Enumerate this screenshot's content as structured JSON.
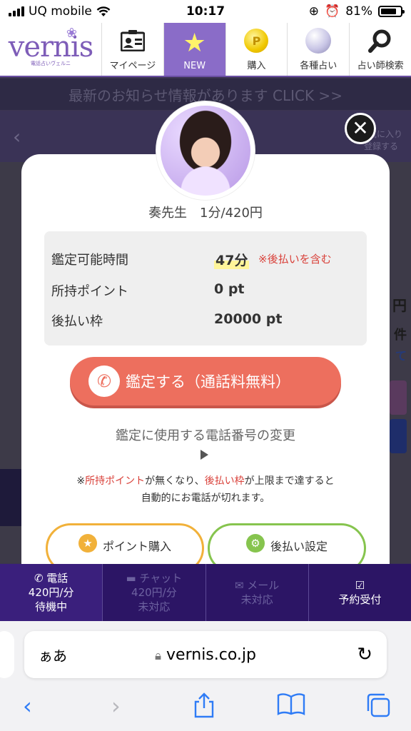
{
  "status_bar": {
    "carrier": "UQ mobile",
    "time": "10:17",
    "battery": "81%",
    "battery_level": 0.81
  },
  "header": {
    "logo": {
      "word": "vernis",
      "sub": "電話占いヴェルニ"
    },
    "nav": [
      {
        "label": "マイページ",
        "icon": "id-card-icon"
      },
      {
        "label": "NEW",
        "icon": "star-icon"
      },
      {
        "label": "購入",
        "icon": "coin-icon",
        "glyph": "P"
      },
      {
        "label": "各種占い",
        "icon": "crystal-ball-icon"
      },
      {
        "label": "占い師検索",
        "icon": "search-icon"
      }
    ]
  },
  "background": {
    "banner": "最新のお知らせ情報があります CLICK >>",
    "fav": "お気に入り\n登録する",
    "right_text_1": "円",
    "right_text_2": "件",
    "right_text_3": "て"
  },
  "modal": {
    "teacher": "奏先生　1分/420円",
    "rows": [
      {
        "label": "鑑定可能時間",
        "value": "47分",
        "note": "※後払いを含む"
      },
      {
        "label": "所持ポイント",
        "value": "0 pt"
      },
      {
        "label": "後払い枠",
        "value": "20000 pt"
      }
    ],
    "call_button": "鑑定する（通話料無料）",
    "change_phone": "鑑定に使用する電話番号の変更",
    "warning": {
      "p1": "※",
      "p2": "所持ポイント",
      "p3": "が無くなり、",
      "p4": "後払い枠",
      "p5": "が上限まで達すると",
      "line2": "自動的にお電話が切れます。"
    },
    "point_button": "ポイント購入",
    "postpay_button": "後払い設定",
    "accent_red": "#ed6f5e",
    "orange": "#f1b13a",
    "green": "#86c44e"
  },
  "tabbar": [
    {
      "title": "電話",
      "price": "420円/分",
      "status": "待機中",
      "icon": "phone-icon",
      "enabled": true
    },
    {
      "title": "チャット",
      "price": "420円/分",
      "status": "未対応",
      "icon": "chat-icon",
      "enabled": false
    },
    {
      "title": "メール",
      "status": "未対応",
      "icon": "mail-icon",
      "enabled": false
    },
    {
      "title": "予約受付",
      "icon": "checkbox-icon",
      "enabled": true
    }
  ],
  "safari": {
    "aa": "ぁあ",
    "url": "vernis.co.jp"
  }
}
